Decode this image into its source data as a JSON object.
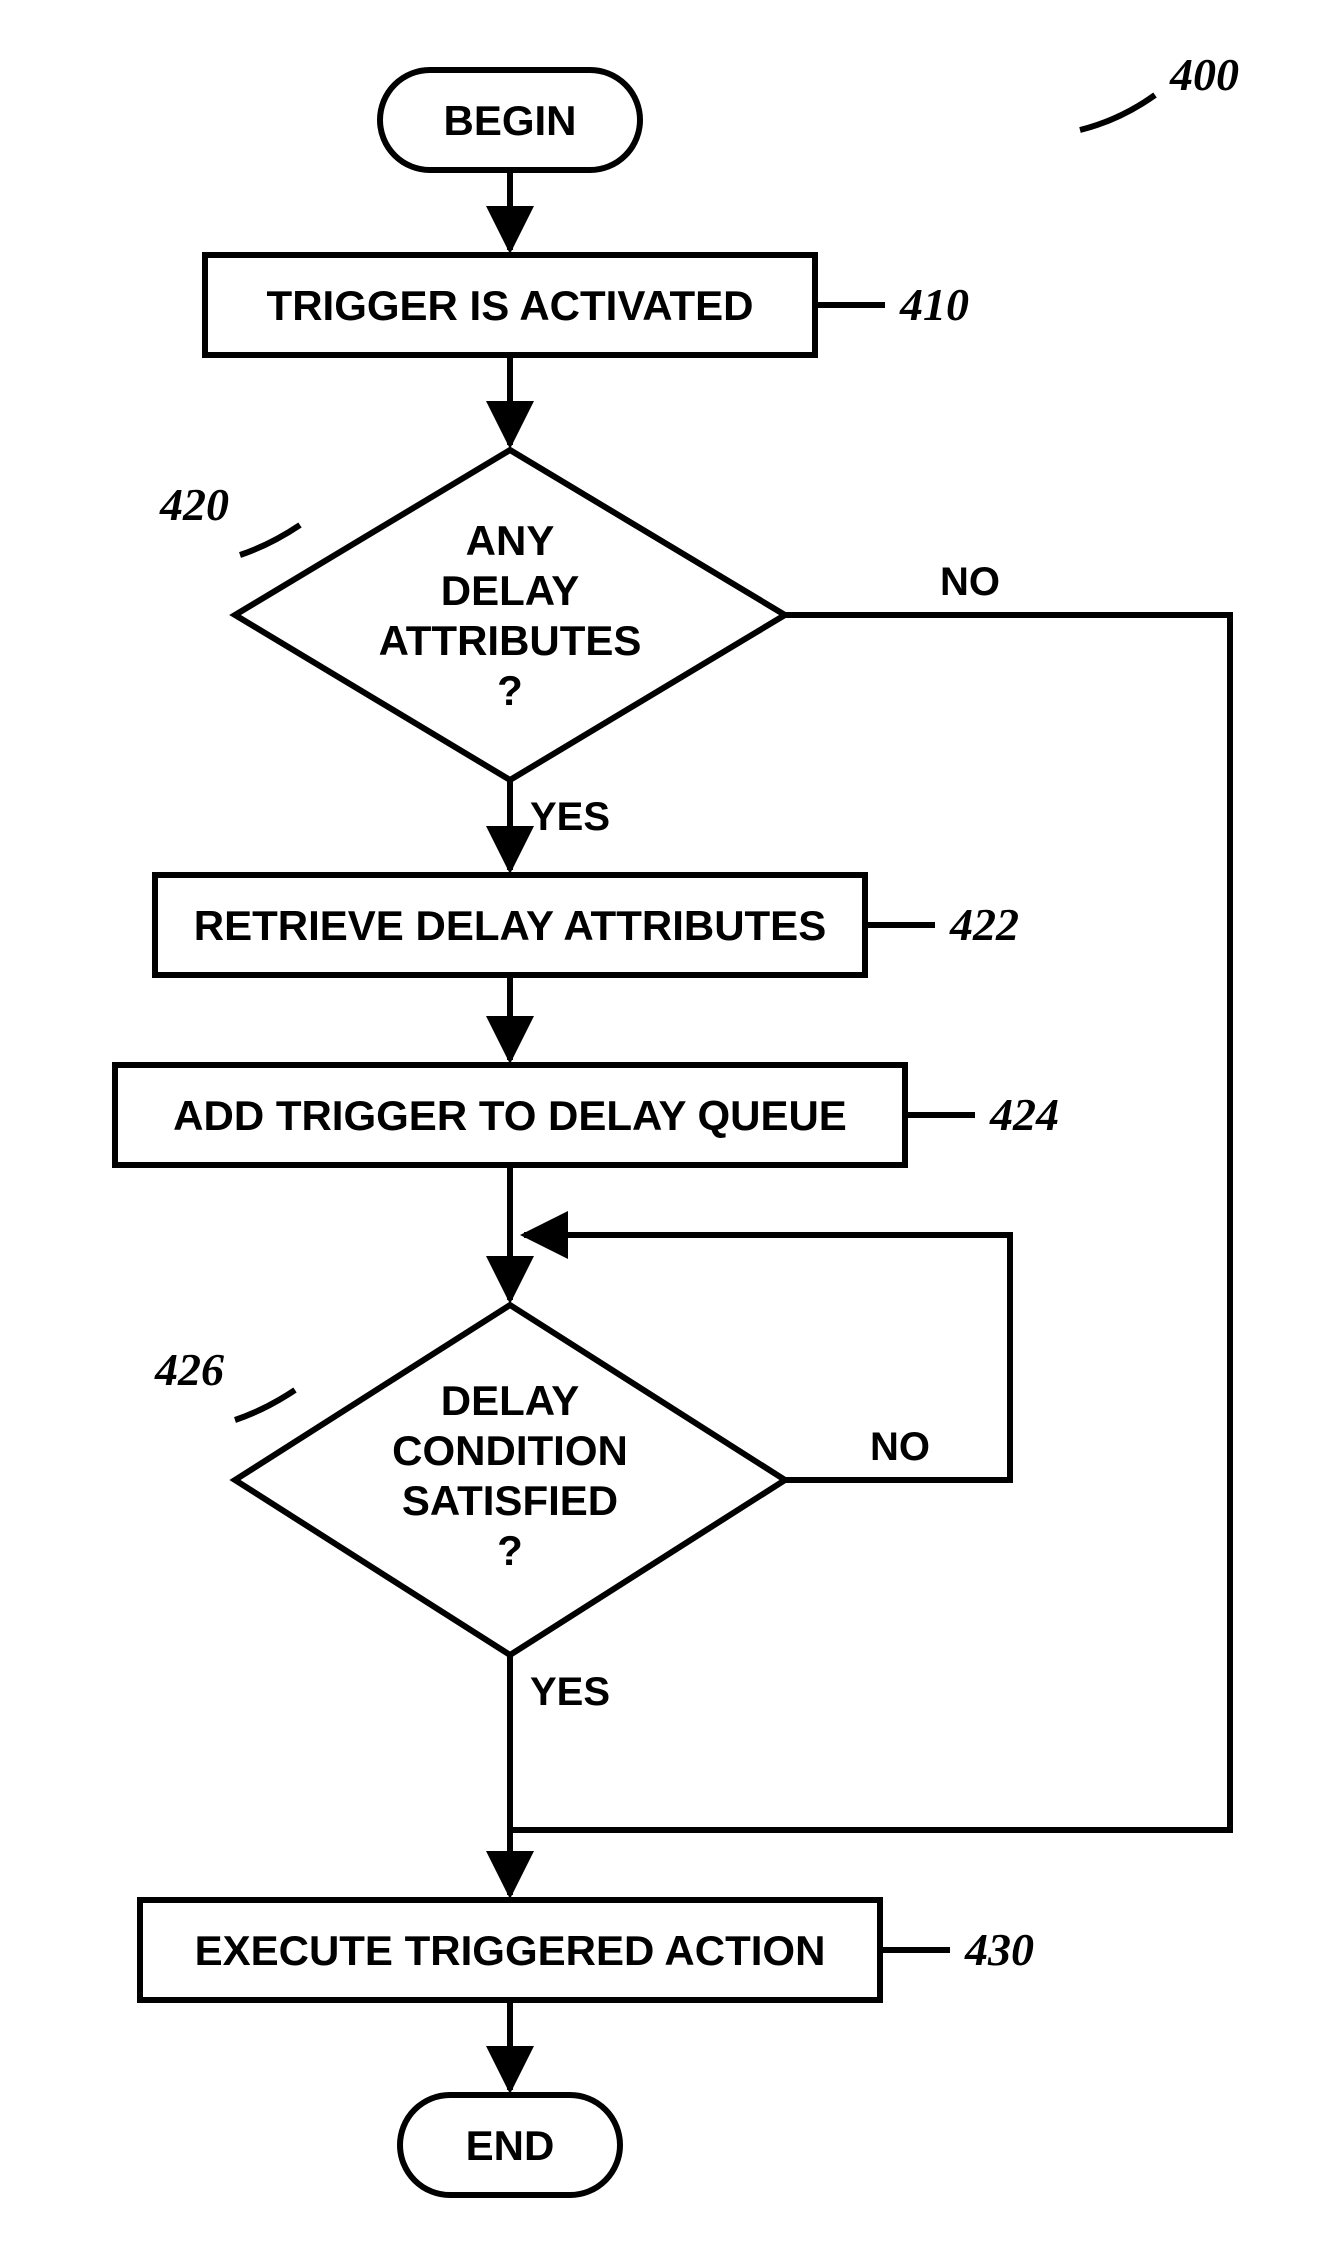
{
  "figure_ref": "400",
  "nodes": {
    "begin": {
      "label": "BEGIN"
    },
    "s410": {
      "label": "TRIGGER IS ACTIVATED",
      "ref": "410"
    },
    "d420": {
      "line1": "ANY",
      "line2": "DELAY",
      "line3": "ATTRIBUTES",
      "line4": "?",
      "ref": "420",
      "yes": "YES",
      "no": "NO"
    },
    "s422": {
      "label": "RETRIEVE DELAY ATTRIBUTES",
      "ref": "422"
    },
    "s424": {
      "label": "ADD TRIGGER TO DELAY QUEUE",
      "ref": "424"
    },
    "d426": {
      "line1": "DELAY",
      "line2": "CONDITION",
      "line3": "SATISFIED",
      "line4": "?",
      "ref": "426",
      "yes": "YES",
      "no": "NO"
    },
    "s430": {
      "label": "EXECUTE TRIGGERED ACTION",
      "ref": "430"
    },
    "end": {
      "label": "END"
    }
  }
}
